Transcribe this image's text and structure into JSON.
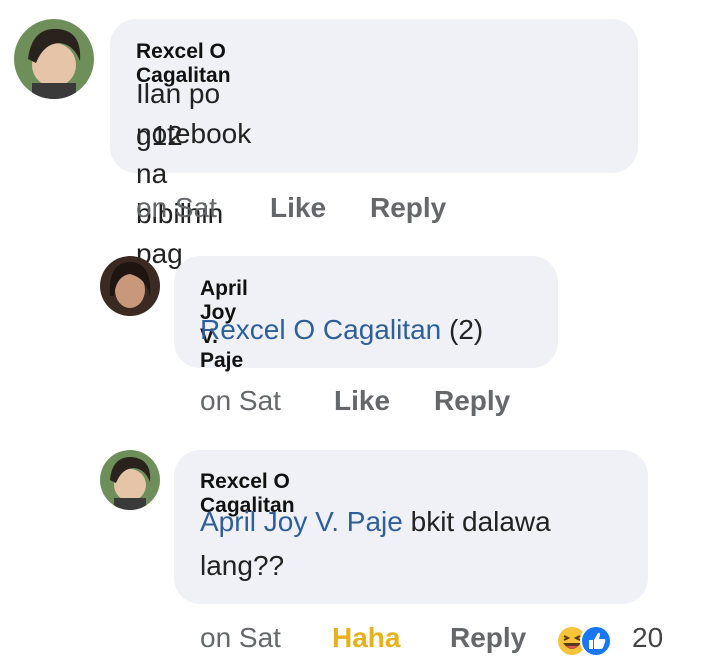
{
  "comments": [
    {
      "author": "Rexcel O Cagalitan",
      "text_line1": "Ilan po notebook na bibilhin pag",
      "text_line2": "g12",
      "time": "on Sat",
      "like": "Like",
      "reply": "Reply"
    },
    {
      "author": "April Joy V. Paje",
      "mention": "Rexcel O Cagalitan",
      "text_after": "(2)",
      "time": "on Sat",
      "like": "Like",
      "reply": "Reply"
    },
    {
      "author": "Rexcel O Cagalitan",
      "mention": "April Joy V. Paje",
      "text_after": "bkit dalawa",
      "text_line2": "lang??",
      "time": "on Sat",
      "reaction_label": "Haha",
      "reply": "Reply",
      "reaction_count": "20",
      "reaction_icons": [
        "haha-emoji-icon",
        "like-thumb-icon"
      ]
    }
  ],
  "colors": {
    "bubble": "#f0f1f6",
    "mention": "#2e5f9a",
    "meta": "#65676b",
    "haha": "#e6b21c",
    "like_blue": "#1877f2"
  }
}
